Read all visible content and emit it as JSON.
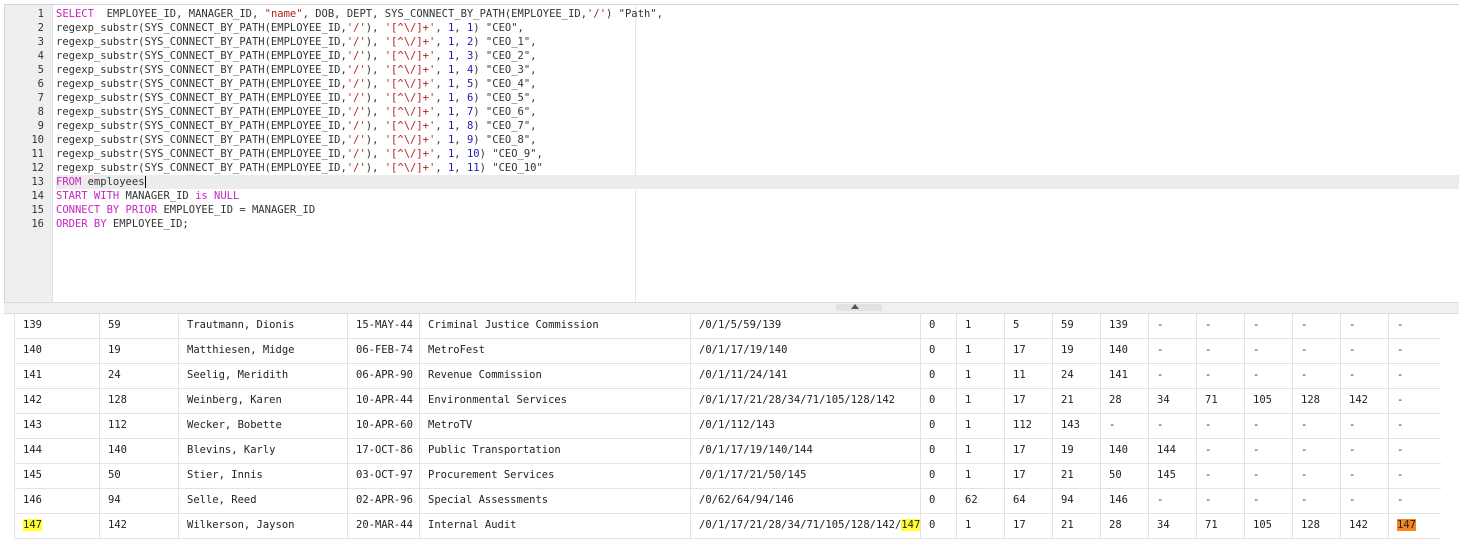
{
  "editor": {
    "lines": [
      {
        "n": "1",
        "segments": [
          [
            "kw",
            "SELECT"
          ],
          [
            "",
            "  EMPLOYEE_ID, MANAGER_ID, "
          ],
          [
            "str",
            "\"name\""
          ],
          [
            "",
            ", DOB, DEPT, SYS_CONNECT_BY_PATH(EMPLOYEE_ID,"
          ],
          [
            "str",
            "'/'"
          ],
          [
            "",
            ") \"Path\","
          ]
        ]
      },
      {
        "n": "2",
        "segments": [
          [
            "",
            "regexp_substr(SYS_CONNECT_BY_PATH(EMPLOYEE_ID,"
          ],
          [
            "str",
            "'/'"
          ],
          [
            "",
            "), "
          ],
          [
            "str",
            "'[^\\/]+'"
          ],
          [
            "",
            ", "
          ],
          [
            "num",
            "1"
          ],
          [
            "",
            ", "
          ],
          [
            "num",
            "1"
          ],
          [
            "",
            ") \"CEO\","
          ]
        ]
      },
      {
        "n": "3",
        "segments": [
          [
            "",
            "regexp_substr(SYS_CONNECT_BY_PATH(EMPLOYEE_ID,"
          ],
          [
            "str",
            "'/'"
          ],
          [
            "",
            "), "
          ],
          [
            "str",
            "'[^\\/]+'"
          ],
          [
            "",
            ", "
          ],
          [
            "num",
            "1"
          ],
          [
            "",
            ", "
          ],
          [
            "num",
            "2"
          ],
          [
            "",
            ") \"CEO_1\","
          ]
        ]
      },
      {
        "n": "4",
        "segments": [
          [
            "",
            "regexp_substr(SYS_CONNECT_BY_PATH(EMPLOYEE_ID,"
          ],
          [
            "str",
            "'/'"
          ],
          [
            "",
            "), "
          ],
          [
            "str",
            "'[^\\/]+'"
          ],
          [
            "",
            ", "
          ],
          [
            "num",
            "1"
          ],
          [
            "",
            ", "
          ],
          [
            "num",
            "3"
          ],
          [
            "",
            ") \"CEO_2\","
          ]
        ]
      },
      {
        "n": "5",
        "segments": [
          [
            "",
            "regexp_substr(SYS_CONNECT_BY_PATH(EMPLOYEE_ID,"
          ],
          [
            "str",
            "'/'"
          ],
          [
            "",
            "), "
          ],
          [
            "str",
            "'[^\\/]+'"
          ],
          [
            "",
            ", "
          ],
          [
            "num",
            "1"
          ],
          [
            "",
            ", "
          ],
          [
            "num",
            "4"
          ],
          [
            "",
            ") \"CEO_3\","
          ]
        ]
      },
      {
        "n": "6",
        "segments": [
          [
            "",
            "regexp_substr(SYS_CONNECT_BY_PATH(EMPLOYEE_ID,"
          ],
          [
            "str",
            "'/'"
          ],
          [
            "",
            "), "
          ],
          [
            "str",
            "'[^\\/]+'"
          ],
          [
            "",
            ", "
          ],
          [
            "num",
            "1"
          ],
          [
            "",
            ", "
          ],
          [
            "num",
            "5"
          ],
          [
            "",
            ") \"CEO_4\","
          ]
        ]
      },
      {
        "n": "7",
        "segments": [
          [
            "",
            "regexp_substr(SYS_CONNECT_BY_PATH(EMPLOYEE_ID,"
          ],
          [
            "str",
            "'/'"
          ],
          [
            "",
            "), "
          ],
          [
            "str",
            "'[^\\/]+'"
          ],
          [
            "",
            ", "
          ],
          [
            "num",
            "1"
          ],
          [
            "",
            ", "
          ],
          [
            "num",
            "6"
          ],
          [
            "",
            ") \"CEO_5\","
          ]
        ]
      },
      {
        "n": "8",
        "segments": [
          [
            "",
            "regexp_substr(SYS_CONNECT_BY_PATH(EMPLOYEE_ID,"
          ],
          [
            "str",
            "'/'"
          ],
          [
            "",
            "), "
          ],
          [
            "str",
            "'[^\\/]+'"
          ],
          [
            "",
            ", "
          ],
          [
            "num",
            "1"
          ],
          [
            "",
            ", "
          ],
          [
            "num",
            "7"
          ],
          [
            "",
            ") \"CEO_6\","
          ]
        ]
      },
      {
        "n": "9",
        "segments": [
          [
            "",
            "regexp_substr(SYS_CONNECT_BY_PATH(EMPLOYEE_ID,"
          ],
          [
            "str",
            "'/'"
          ],
          [
            "",
            "), "
          ],
          [
            "str",
            "'[^\\/]+'"
          ],
          [
            "",
            ", "
          ],
          [
            "num",
            "1"
          ],
          [
            "",
            ", "
          ],
          [
            "num",
            "8"
          ],
          [
            "",
            ") \"CEO_7\","
          ]
        ]
      },
      {
        "n": "10",
        "segments": [
          [
            "",
            "regexp_substr(SYS_CONNECT_BY_PATH(EMPLOYEE_ID,"
          ],
          [
            "str",
            "'/'"
          ],
          [
            "",
            "), "
          ],
          [
            "str",
            "'[^\\/]+'"
          ],
          [
            "",
            ", "
          ],
          [
            "num",
            "1"
          ],
          [
            "",
            ", "
          ],
          [
            "num",
            "9"
          ],
          [
            "",
            ") \"CEO_8\","
          ]
        ]
      },
      {
        "n": "11",
        "segments": [
          [
            "",
            "regexp_substr(SYS_CONNECT_BY_PATH(EMPLOYEE_ID,"
          ],
          [
            "str",
            "'/'"
          ],
          [
            "",
            "), "
          ],
          [
            "str",
            "'[^\\/]+'"
          ],
          [
            "",
            ", "
          ],
          [
            "num",
            "1"
          ],
          [
            "",
            ", "
          ],
          [
            "num",
            "10"
          ],
          [
            "",
            ") \"CEO_9\","
          ]
        ]
      },
      {
        "n": "12",
        "segments": [
          [
            "",
            "regexp_substr(SYS_CONNECT_BY_PATH(EMPLOYEE_ID,"
          ],
          [
            "str",
            "'/'"
          ],
          [
            "",
            "), "
          ],
          [
            "str",
            "'[^\\/]+'"
          ],
          [
            "",
            ", "
          ],
          [
            "num",
            "1"
          ],
          [
            "",
            ", "
          ],
          [
            "num",
            "11"
          ],
          [
            "",
            ") \"CEO_10\""
          ]
        ]
      },
      {
        "n": "13",
        "segments": [
          [
            "kw",
            "FROM"
          ],
          [
            "",
            " employees"
          ]
        ],
        "active": true
      },
      {
        "n": "14",
        "segments": [
          [
            "kw",
            "START WITH"
          ],
          [
            "",
            " MANAGER_ID "
          ],
          [
            "kw",
            "is NULL"
          ]
        ]
      },
      {
        "n": "15",
        "segments": [
          [
            "kw",
            "CONNECT BY PRIOR"
          ],
          [
            "",
            " EMPLOYEE_ID = MANAGER_ID"
          ]
        ]
      },
      {
        "n": "16",
        "segments": [
          [
            "kw",
            "ORDER BY"
          ],
          [
            "",
            " EMPLOYEE_ID;"
          ]
        ]
      }
    ]
  },
  "results": {
    "rows": [
      [
        "139",
        "59",
        "Trautmann, Dionis",
        "15-MAY-44",
        "Criminal Justice Commission",
        "/0/1/5/59/139",
        "0",
        "1",
        "5",
        "59",
        "139",
        "-",
        "-",
        "-",
        "-",
        "-",
        "-"
      ],
      [
        "140",
        "19",
        "Matthiesen, Midge",
        "06-FEB-74",
        "MetroFest",
        "/0/1/17/19/140",
        "0",
        "1",
        "17",
        "19",
        "140",
        "-",
        "-",
        "-",
        "-",
        "-",
        "-"
      ],
      [
        "141",
        "24",
        "Seelig, Meridith",
        "06-APR-90",
        "Revenue Commission",
        "/0/1/11/24/141",
        "0",
        "1",
        "11",
        "24",
        "141",
        "-",
        "-",
        "-",
        "-",
        "-",
        "-"
      ],
      [
        "142",
        "128",
        "Weinberg, Karen",
        "10-APR-44",
        "Environmental Services",
        "/0/1/17/21/28/34/71/105/128/142",
        "0",
        "1",
        "17",
        "21",
        "28",
        "34",
        "71",
        "105",
        "128",
        "142",
        "-"
      ],
      [
        "143",
        "112",
        "Wecker, Bobette",
        "10-APR-60",
        "MetroTV",
        "/0/1/112/143",
        "0",
        "1",
        "112",
        "143",
        "-",
        "-",
        "-",
        "-",
        "-",
        "-",
        "-"
      ],
      [
        "144",
        "140",
        "Blevins, Karly",
        "17-OCT-86",
        "Public Transportation",
        "/0/1/17/19/140/144",
        "0",
        "1",
        "17",
        "19",
        "140",
        "144",
        "-",
        "-",
        "-",
        "-",
        "-"
      ],
      [
        "145",
        "50",
        "Stier, Innis",
        "03-OCT-97",
        "Procurement Services",
        "/0/1/17/21/50/145",
        "0",
        "1",
        "17",
        "21",
        "50",
        "145",
        "-",
        "-",
        "-",
        "-",
        "-"
      ],
      [
        "146",
        "94",
        "Selle, Reed",
        "02-APR-96",
        "Special Assessments",
        "/0/62/64/94/146",
        "0",
        "62",
        "64",
        "94",
        "146",
        "-",
        "-",
        "-",
        "-",
        "-",
        "-"
      ],
      [
        "147",
        "142",
        "Wilkerson, Jayson",
        "20-MAR-44",
        "Internal Audit",
        "/0/1/17/21/28/34/71/105/128/142/",
        "0",
        "1",
        "17",
        "21",
        "28",
        "34",
        "71",
        "105",
        "128",
        "142",
        "147"
      ]
    ],
    "path_suffix_147": "147",
    "highlight_yellow": "#ffff33",
    "highlight_orange": "#f5861f"
  }
}
